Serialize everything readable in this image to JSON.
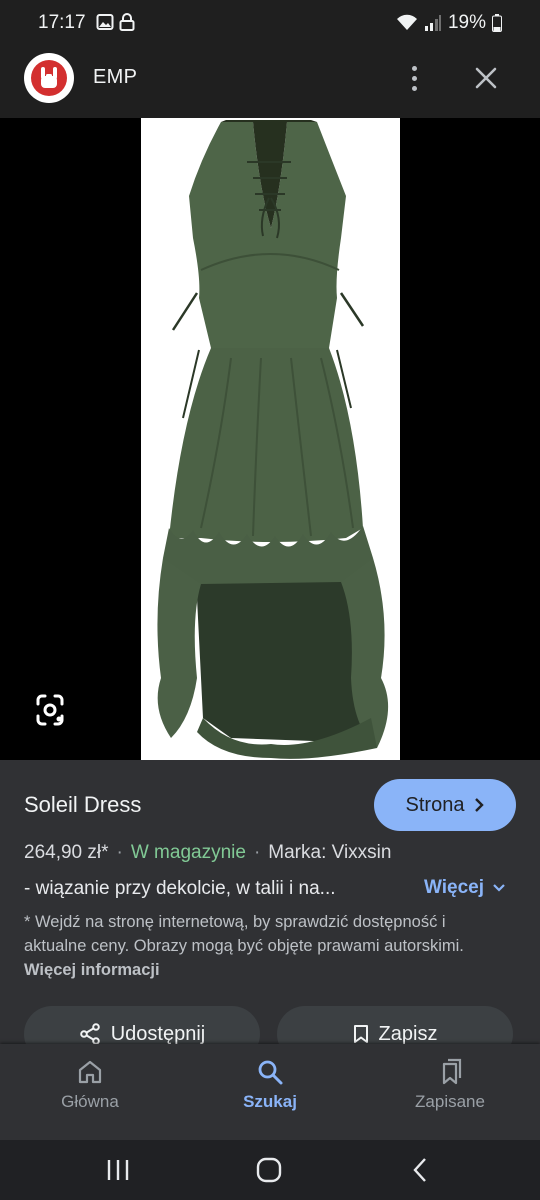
{
  "status_bar": {
    "time": "17:17",
    "battery": "19%"
  },
  "header": {
    "site_name": "EMP",
    "logo_icon": "emp-rock-hand-logo",
    "more_icon": "more-vert-icon",
    "close_icon": "close-icon"
  },
  "image": {
    "alt": "Soleil Dress",
    "lens_icon": "google-lens-icon"
  },
  "product": {
    "title": "Soleil Dress",
    "visit_label": "Strona",
    "price": "264,90 zł*",
    "stock": "W magazynie",
    "brand": "Marka: Vixxsin",
    "description": "- wiązanie przy dekolcie, w talii i na...",
    "more_label": "Więcej",
    "disclaimer": "* Wejdź na stronę internetową, by sprawdzić dostępność i aktualne ceny. Obrazy mogą być objęte prawami autorskimi.",
    "more_info": "Więcej informacji",
    "share_label": "Udostępnij",
    "save_label": "Zapisz"
  },
  "bottom_nav": [
    {
      "label": "Główna",
      "icon": "home-icon",
      "active": false
    },
    {
      "label": "Szukaj",
      "icon": "search-icon",
      "active": true
    },
    {
      "label": "Zapisane",
      "icon": "bookmarks-icon",
      "active": false
    }
  ],
  "colors": {
    "accent": "#8ab4f8",
    "stock_green": "#81c995",
    "panel": "#303134",
    "dress_green": "#4e6548"
  }
}
